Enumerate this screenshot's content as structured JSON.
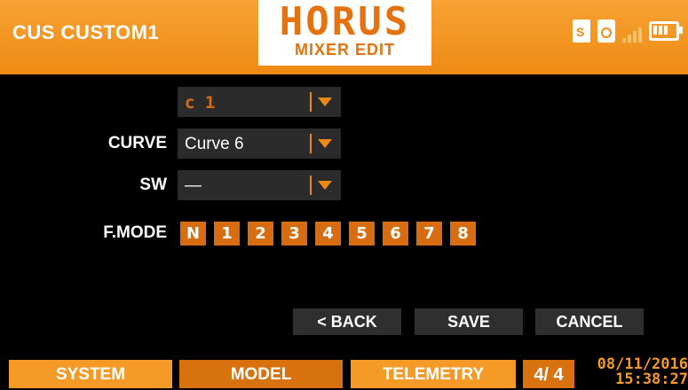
{
  "header": {
    "title": "CUS CUSTOM1",
    "logo": "HORUS",
    "subtitle": "MIXER EDIT"
  },
  "form": {
    "source_value": "c 1",
    "curve_label": "CURVE",
    "curve_value": "Curve 6",
    "sw_label": "SW",
    "sw_value": "—",
    "fmode_label": "F.MODE",
    "fmodes": [
      "N",
      "1",
      "2",
      "3",
      "4",
      "5",
      "6",
      "7",
      "8"
    ]
  },
  "actions": {
    "back": "< BACK",
    "save": "SAVE",
    "cancel": "CANCEL"
  },
  "footer": {
    "tabs": [
      "SYSTEM",
      "MODEL",
      "TELEMETRY"
    ],
    "active_tab": "MODEL",
    "page": "4/ 4",
    "date": "08/11/2016",
    "time": "15:38:27"
  },
  "colors": {
    "accent": "#ee8a14",
    "accent_dark": "#d76d10",
    "panel": "#2b2b2b"
  },
  "icons": [
    "sd-card-icon",
    "record-icon",
    "signal-strength-icon",
    "battery-icon",
    "dropdown-arrow-icon"
  ]
}
